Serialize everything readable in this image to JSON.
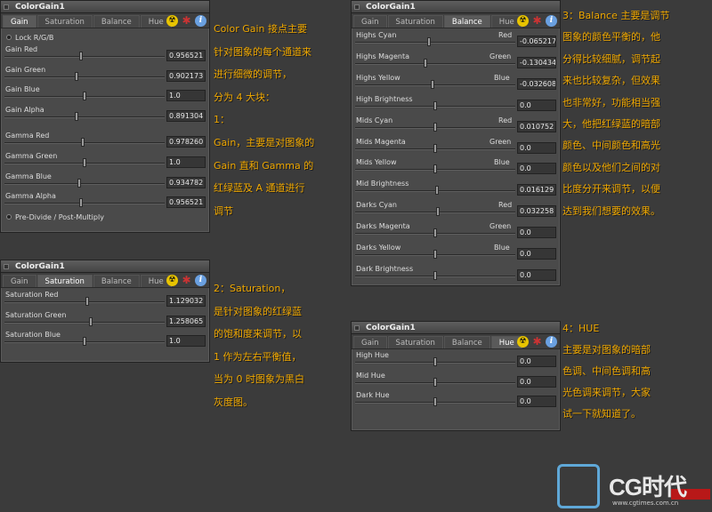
{
  "panel1": {
    "title": "ColorGain1",
    "tabs": [
      "Gain",
      "Saturation",
      "Balance",
      "Hue"
    ],
    "active_tab": "Gain",
    "lock": "Lock R/G/B",
    "rows": [
      {
        "label": "Gain Red",
        "value": "0.956521",
        "level": 0.478
      },
      {
        "label": "Gain Green",
        "value": "0.902173",
        "level": 0.45
      },
      {
        "label": "Gain Blue",
        "value": "1.0",
        "level": 0.5
      },
      {
        "label": "Gain Alpha",
        "value": "0.891304",
        "level": 0.445
      },
      {
        "label": "Gamma Red",
        "value": "0.978260",
        "level": 0.489
      },
      {
        "label": "Gamma Green",
        "value": "1.0",
        "level": 0.5
      },
      {
        "label": "Gamma Blue",
        "value": "0.934782",
        "level": 0.467
      },
      {
        "label": "Gamma Alpha",
        "value": "0.956521",
        "level": 0.478
      }
    ],
    "predivide": "Pre-Divide / Post-Multiply"
  },
  "panel2": {
    "title": "ColorGain1",
    "tabs": [
      "Gain",
      "Saturation",
      "Balance",
      "Hue"
    ],
    "active_tab": "Saturation",
    "rows": [
      {
        "label": "Saturation Red",
        "value": "1.129032",
        "level": 0.52
      },
      {
        "label": "Saturation Green",
        "value": "1.258065",
        "level": 0.54
      },
      {
        "label": "Saturation Blue",
        "value": "1.0",
        "level": 0.5
      }
    ]
  },
  "panel3": {
    "title": "ColorGain1",
    "tabs": [
      "Gain",
      "Saturation",
      "Balance",
      "Hue"
    ],
    "active_tab": "Balance",
    "rows": [
      {
        "label": "Highs  Cyan",
        "right": "Red",
        "value": "-0.065217",
        "level": 0.46
      },
      {
        "label": "Highs  Magenta",
        "right": "Green",
        "value": "-0.130434",
        "level": 0.435
      },
      {
        "label": "Highs  Yellow",
        "right": "Blue",
        "value": "-0.032608",
        "level": 0.48
      },
      {
        "label": "High Brightness",
        "right": "",
        "value": "0.0",
        "level": 0.5
      },
      {
        "label": "Mids  Cyan",
        "right": "Red",
        "value": "0.010752",
        "level": 0.5
      },
      {
        "label": "Mids  Magenta",
        "right": "Green",
        "value": "0.0",
        "level": 0.5
      },
      {
        "label": "Mids  Yellow",
        "right": "Blue",
        "value": "0.0",
        "level": 0.5
      },
      {
        "label": "Mid Brightness",
        "right": "",
        "value": "0.016129",
        "level": 0.51
      },
      {
        "label": "Darks  Cyan",
        "right": "Red",
        "value": "0.032258",
        "level": 0.52
      },
      {
        "label": "Darks  Magenta",
        "right": "Green",
        "value": "0.0",
        "level": 0.5
      },
      {
        "label": "Darks  Yellow",
        "right": "Blue",
        "value": "0.0",
        "level": 0.5
      },
      {
        "label": "Dark Brightness",
        "right": "",
        "value": "0.0",
        "level": 0.5
      }
    ]
  },
  "panel4": {
    "title": "ColorGain1",
    "tabs": [
      "Gain",
      "Saturation",
      "Balance",
      "Hue"
    ],
    "active_tab": "Hue",
    "rows": [
      {
        "label": "High Hue",
        "value": "0.0",
        "level": 0.5
      },
      {
        "label": "Mid Hue",
        "value": "0.0",
        "level": 0.5
      },
      {
        "label": "Dark Hue",
        "value": "0.0",
        "level": 0.5
      }
    ]
  },
  "notes": {
    "n1": [
      "Color Gain 接点主要",
      "针对图象的每个通道来",
      "进行细微的调节，",
      "分为 4 大块：",
      "1：",
      "Gain，主要是对图象的",
      "Gain 直和 Gamma 的",
      "红绿蓝及 A 通道进行",
      "调节"
    ],
    "n2": [
      "2：Saturation，",
      "是针对图象的红绿蓝",
      "的饱和度来调节，以",
      "1 作为左右平衡值，",
      "当为 0 时图象为黑白",
      "灰度图。"
    ],
    "n3": [
      "3：Balance 主要是调节",
      "图象的颜色平衡的，他",
      "分得比较细腻，调节起",
      "来也比较复杂，但效果",
      "也非常好，功能相当强",
      "大，他把红绿蓝的暗部",
      "颜色、中间颜色和高光",
      "颜色以及他们之间的对",
      "比度分开来调节，以便",
      "达到我们想要的效果。"
    ],
    "n4": [
      "4：HUE",
      "主要是对图象的暗部",
      "色调、中间色调和高",
      "光色调来调节，大家",
      "试一下就知道了。"
    ]
  },
  "logo": {
    "text": "CG时代",
    "site": "www.cgtimes.com.cn"
  },
  "colors": {
    "note": "#f0a800",
    "panel": "#4a4a4a",
    "background": "#3b3b3b"
  }
}
